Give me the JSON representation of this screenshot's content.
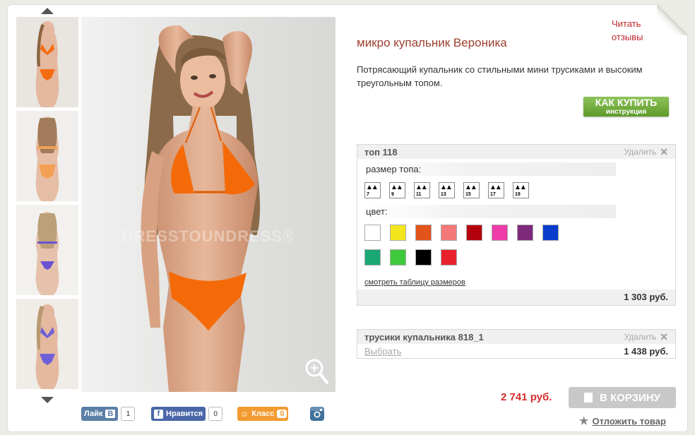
{
  "product": {
    "title": "микро купальник Вероника",
    "description": "Потрясающий купальник со стильными мини трусиками и высоким треугольным топом.",
    "reviews_link": "Читать отзывы",
    "how_to_buy": {
      "line1": "КАК КУПИТЬ",
      "line2": "инструкция"
    },
    "watermark": "DRESSTOUNDRESS®"
  },
  "gallery": {
    "thumbnails": [
      {
        "label": "front-orange"
      },
      {
        "label": "back-orange"
      },
      {
        "label": "back-purple"
      },
      {
        "label": "front-purple"
      }
    ]
  },
  "top_box": {
    "name": "топ 118",
    "remove_label": "Удалить",
    "size_label": "размер топа:",
    "sizes": [
      "7",
      "9",
      "11",
      "13",
      "15",
      "17",
      "19"
    ],
    "color_label": "цвет:",
    "colors": [
      "#ffffff",
      "#f4e61c",
      "#e2541a",
      "#f37878",
      "#b5000e",
      "#f03ca8",
      "#7e2a7a",
      "#0a3ccc",
      "#1aa874",
      "#3ec93c",
      "#000000",
      "#e8222c"
    ],
    "size_table_link": "смотреть таблицу размеров",
    "price": "1 303 руб."
  },
  "bottom_box": {
    "name": "трусики купальника 818_1",
    "remove_label": "Удалить",
    "choose_label": "Выбрать",
    "price": "1 438 руб."
  },
  "order": {
    "total": "2 741 руб.",
    "cart_label": "В КОРЗИНУ",
    "later_label": "Отложить товар"
  },
  "social": {
    "vk": {
      "label": "Лайк",
      "badge": "В",
      "count": "1"
    },
    "fb": {
      "label": "Нравится",
      "count": "0"
    },
    "ok": {
      "label": "Класс",
      "count": "0"
    }
  },
  "colors": {
    "accent_red": "#c0272d",
    "price_red": "#d42d2d",
    "green": "#6aa833"
  }
}
